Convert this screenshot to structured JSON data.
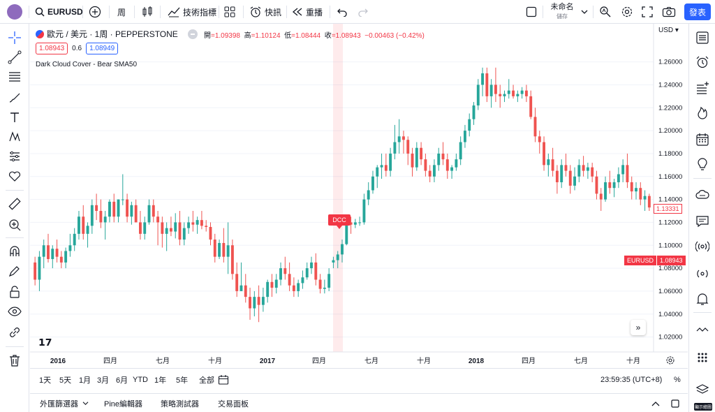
{
  "topbar": {
    "symbol": "EURUSD",
    "interval": "周",
    "indicators": "技術指標",
    "alert": "快訊",
    "replay": "重播",
    "layout_name": "未命名",
    "layout_save": "儲存",
    "signup": "發表"
  },
  "legend": {
    "pair": "歐元 / 美元 · 1周 · PEPPERSTONE",
    "o_lbl": "開",
    "o": "=1.09398",
    "h_lbl": "高",
    "h": "=1.10124",
    "l_lbl": "低",
    "l": "=1.08444",
    "c_lbl": "收",
    "c": "=1.08943",
    "chg": "−0.00463 (−0.42%)",
    "sell": "1.08943",
    "spread": "0.6",
    "buy": "1.08949",
    "study": "Dark Cloud Cover - Bear SMA50",
    "dcc": "DCC"
  },
  "axis": {
    "currency": "USD",
    "ticks": [
      "1.26000",
      "1.24000",
      "1.22000",
      "1.20000",
      "1.18000",
      "1.16000",
      "1.14000",
      "1.12000",
      "1.10000",
      "1.08000",
      "1.06000",
      "1.04000",
      "1.02000"
    ],
    "eur_tag": "EURUSD",
    "eur_price": "1.08943",
    "close_tag": "1.13331"
  },
  "xaxis": [
    "2016",
    "四月",
    "七月",
    "十月",
    "2017",
    "四月",
    "七月",
    "十月",
    "2018",
    "四月",
    "七月",
    "十月"
  ],
  "ranges": [
    "1天",
    "5天",
    "1月",
    "3月",
    "6月",
    "YTD",
    "1年",
    "5年",
    "全部"
  ],
  "time": "23:59:35 (UTC+8)",
  "pct": "%",
  "bottom": {
    "tabs": [
      "外匯篩選器",
      "Pine編輯器",
      "策略測試器",
      "交易面板"
    ]
  },
  "show_draw": "顯示繪圖",
  "colors": {
    "up": "#26a69a",
    "down": "#ef5350",
    "accent": "#2962ff"
  },
  "chart_data": {
    "type": "candlestick",
    "series": [
      {
        "o": 1.085,
        "h": 1.09,
        "l": 1.065,
        "c": 1.07
      },
      {
        "o": 1.07,
        "h": 1.095,
        "l": 1.06,
        "c": 1.09
      },
      {
        "o": 1.09,
        "h": 1.105,
        "l": 1.08,
        "c": 1.1
      },
      {
        "o": 1.1,
        "h": 1.11,
        "l": 1.085,
        "c": 1.088
      },
      {
        "o": 1.088,
        "h": 1.1,
        "l": 1.08,
        "c": 1.097
      },
      {
        "o": 1.097,
        "h": 1.105,
        "l": 1.085,
        "c": 1.09
      },
      {
        "o": 1.09,
        "h": 1.095,
        "l": 1.08,
        "c": 1.085
      },
      {
        "o": 1.085,
        "h": 1.098,
        "l": 1.08,
        "c": 1.095
      },
      {
        "o": 1.095,
        "h": 1.11,
        "l": 1.09,
        "c": 1.1
      },
      {
        "o": 1.1,
        "h": 1.115,
        "l": 1.095,
        "c": 1.11
      },
      {
        "o": 1.11,
        "h": 1.13,
        "l": 1.105,
        "c": 1.125
      },
      {
        "o": 1.125,
        "h": 1.135,
        "l": 1.105,
        "c": 1.11
      },
      {
        "o": 1.11,
        "h": 1.12,
        "l": 1.098,
        "c": 1.117
      },
      {
        "o": 1.117,
        "h": 1.14,
        "l": 1.11,
        "c": 1.135
      },
      {
        "o": 1.135,
        "h": 1.145,
        "l": 1.122,
        "c": 1.13
      },
      {
        "o": 1.13,
        "h": 1.14,
        "l": 1.115,
        "c": 1.12
      },
      {
        "o": 1.12,
        "h": 1.13,
        "l": 1.105,
        "c": 1.125
      },
      {
        "o": 1.125,
        "h": 1.14,
        "l": 1.12,
        "c": 1.138
      },
      {
        "o": 1.138,
        "h": 1.145,
        "l": 1.12,
        "c": 1.125
      },
      {
        "o": 1.125,
        "h": 1.14,
        "l": 1.12,
        "c": 1.14
      },
      {
        "o": 1.14,
        "h": 1.162,
        "l": 1.135,
        "c": 1.14
      },
      {
        "o": 1.14,
        "h": 1.145,
        "l": 1.12,
        "c": 1.125
      },
      {
        "o": 1.125,
        "h": 1.138,
        "l": 1.118,
        "c": 1.135
      },
      {
        "o": 1.135,
        "h": 1.14,
        "l": 1.12,
        "c": 1.12
      },
      {
        "o": 1.12,
        "h": 1.13,
        "l": 1.105,
        "c": 1.11
      },
      {
        "o": 1.11,
        "h": 1.125,
        "l": 1.105,
        "c": 1.12
      },
      {
        "o": 1.12,
        "h": 1.14,
        "l": 1.118,
        "c": 1.135
      },
      {
        "o": 1.135,
        "h": 1.14,
        "l": 1.12,
        "c": 1.125
      },
      {
        "o": 1.125,
        "h": 1.13,
        "l": 1.1,
        "c": 1.12
      },
      {
        "o": 1.12,
        "h": 1.125,
        "l": 1.098,
        "c": 1.11
      },
      {
        "o": 1.11,
        "h": 1.12,
        "l": 1.095,
        "c": 1.115
      },
      {
        "o": 1.115,
        "h": 1.125,
        "l": 1.108,
        "c": 1.112
      },
      {
        "o": 1.112,
        "h": 1.128,
        "l": 1.106,
        "c": 1.12
      },
      {
        "o": 1.12,
        "h": 1.13,
        "l": 1.1,
        "c": 1.105
      },
      {
        "o": 1.105,
        "h": 1.12,
        "l": 1.1,
        "c": 1.115
      },
      {
        "o": 1.115,
        "h": 1.125,
        "l": 1.11,
        "c": 1.12
      },
      {
        "o": 1.12,
        "h": 1.13,
        "l": 1.112,
        "c": 1.118
      },
      {
        "o": 1.118,
        "h": 1.125,
        "l": 1.11,
        "c": 1.122
      },
      {
        "o": 1.122,
        "h": 1.13,
        "l": 1.114,
        "c": 1.117
      },
      {
        "o": 1.117,
        "h": 1.122,
        "l": 1.112,
        "c": 1.116
      },
      {
        "o": 1.116,
        "h": 1.12,
        "l": 1.1,
        "c": 1.105
      },
      {
        "o": 1.105,
        "h": 1.11,
        "l": 1.085,
        "c": 1.09
      },
      {
        "o": 1.09,
        "h": 1.105,
        "l": 1.088,
        "c": 1.102
      },
      {
        "o": 1.102,
        "h": 1.115,
        "l": 1.085,
        "c": 1.09
      },
      {
        "o": 1.09,
        "h": 1.12,
        "l": 1.075,
        "c": 1.1
      },
      {
        "o": 1.1,
        "h": 1.105,
        "l": 1.07,
        "c": 1.075
      },
      {
        "o": 1.075,
        "h": 1.085,
        "l": 1.055,
        "c": 1.06
      },
      {
        "o": 1.06,
        "h": 1.085,
        "l": 1.06,
        "c": 1.065
      },
      {
        "o": 1.065,
        "h": 1.075,
        "l": 1.05,
        "c": 1.055
      },
      {
        "o": 1.055,
        "h": 1.063,
        "l": 1.035,
        "c": 1.045
      },
      {
        "o": 1.045,
        "h": 1.06,
        "l": 1.038,
        "c": 1.055
      },
      {
        "o": 1.055,
        "h": 1.065,
        "l": 1.033,
        "c": 1.048
      },
      {
        "o": 1.048,
        "h": 1.063,
        "l": 1.042,
        "c": 1.055
      },
      {
        "o": 1.055,
        "h": 1.07,
        "l": 1.05,
        "c": 1.068
      },
      {
        "o": 1.068,
        "h": 1.075,
        "l": 1.055,
        "c": 1.063
      },
      {
        "o": 1.063,
        "h": 1.075,
        "l": 1.058,
        "c": 1.07
      },
      {
        "o": 1.07,
        "h": 1.085,
        "l": 1.065,
        "c": 1.08
      },
      {
        "o": 1.08,
        "h": 1.09,
        "l": 1.07,
        "c": 1.075
      },
      {
        "o": 1.075,
        "h": 1.085,
        "l": 1.06,
        "c": 1.065
      },
      {
        "o": 1.065,
        "h": 1.072,
        "l": 1.055,
        "c": 1.06
      },
      {
        "o": 1.06,
        "h": 1.07,
        "l": 1.055,
        "c": 1.067
      },
      {
        "o": 1.067,
        "h": 1.078,
        "l": 1.062,
        "c": 1.072
      },
      {
        "o": 1.072,
        "h": 1.085,
        "l": 1.07,
        "c": 1.08
      },
      {
        "o": 1.08,
        "h": 1.09,
        "l": 1.075,
        "c": 1.085
      },
      {
        "o": 1.085,
        "h": 1.093,
        "l": 1.065,
        "c": 1.07
      },
      {
        "o": 1.07,
        "h": 1.075,
        "l": 1.058,
        "c": 1.062
      },
      {
        "o": 1.062,
        "h": 1.07,
        "l": 1.058,
        "c": 1.063
      },
      {
        "o": 1.063,
        "h": 1.08,
        "l": 1.06,
        "c": 1.075
      },
      {
        "o": 1.085,
        "h": 1.09,
        "l": 1.08,
        "c": 1.087
      },
      {
        "o": 1.087,
        "h": 1.095,
        "l": 1.08,
        "c": 1.092
      },
      {
        "o": 1.092,
        "h": 1.105,
        "l": 1.085,
        "c": 1.101
      },
      {
        "o": 1.101,
        "h": 1.12,
        "l": 1.1,
        "c": 1.12
      },
      {
        "o": 1.12,
        "h": 1.125,
        "l": 1.11,
        "c": 1.118
      },
      {
        "o": 1.118,
        "h": 1.123,
        "l": 1.115,
        "c": 1.12
      },
      {
        "o": 1.12,
        "h": 1.125,
        "l": 1.117,
        "c": 1.12
      },
      {
        "o": 1.12,
        "h": 1.145,
        "l": 1.118,
        "c": 1.14
      },
      {
        "o": 1.14,
        "h": 1.155,
        "l": 1.135,
        "c": 1.148
      },
      {
        "o": 1.148,
        "h": 1.165,
        "l": 1.145,
        "c": 1.16
      },
      {
        "o": 1.16,
        "h": 1.17,
        "l": 1.15,
        "c": 1.168
      },
      {
        "o": 1.168,
        "h": 1.18,
        "l": 1.158,
        "c": 1.17
      },
      {
        "o": 1.17,
        "h": 1.18,
        "l": 1.16,
        "c": 1.165
      },
      {
        "o": 1.165,
        "h": 1.185,
        "l": 1.16,
        "c": 1.18
      },
      {
        "o": 1.18,
        "h": 1.205,
        "l": 1.175,
        "c": 1.19
      },
      {
        "o": 1.19,
        "h": 1.21,
        "l": 1.18,
        "c": 1.195
      },
      {
        "o": 1.195,
        "h": 1.2,
        "l": 1.18,
        "c": 1.192
      },
      {
        "o": 1.192,
        "h": 1.195,
        "l": 1.17,
        "c": 1.18
      },
      {
        "o": 1.18,
        "h": 1.185,
        "l": 1.16,
        "c": 1.168
      },
      {
        "o": 1.168,
        "h": 1.19,
        "l": 1.165,
        "c": 1.185
      },
      {
        "o": 1.185,
        "h": 1.19,
        "l": 1.17,
        "c": 1.175
      },
      {
        "o": 1.175,
        "h": 1.18,
        "l": 1.16,
        "c": 1.165
      },
      {
        "o": 1.165,
        "h": 1.17,
        "l": 1.155,
        "c": 1.16
      },
      {
        "o": 1.16,
        "h": 1.175,
        "l": 1.155,
        "c": 1.17
      },
      {
        "o": 1.17,
        "h": 1.185,
        "l": 1.165,
        "c": 1.18
      },
      {
        "o": 1.18,
        "h": 1.19,
        "l": 1.17,
        "c": 1.175
      },
      {
        "o": 1.175,
        "h": 1.18,
        "l": 1.158,
        "c": 1.165
      },
      {
        "o": 1.165,
        "h": 1.17,
        "l": 1.158,
        "c": 1.168
      },
      {
        "o": 1.168,
        "h": 1.18,
        "l": 1.165,
        "c": 1.175
      },
      {
        "o": 1.175,
        "h": 1.195,
        "l": 1.17,
        "c": 1.19
      },
      {
        "o": 1.19,
        "h": 1.205,
        "l": 1.185,
        "c": 1.2
      },
      {
        "o": 1.2,
        "h": 1.215,
        "l": 1.195,
        "c": 1.21
      },
      {
        "o": 1.21,
        "h": 1.225,
        "l": 1.205,
        "c": 1.222
      },
      {
        "o": 1.222,
        "h": 1.245,
        "l": 1.218,
        "c": 1.24
      },
      {
        "o": 1.24,
        "h": 1.255,
        "l": 1.23,
        "c": 1.25
      },
      {
        "o": 1.25,
        "h": 1.255,
        "l": 1.225,
        "c": 1.23
      },
      {
        "o": 1.23,
        "h": 1.245,
        "l": 1.22,
        "c": 1.24
      },
      {
        "o": 1.24,
        "h": 1.255,
        "l": 1.225,
        "c": 1.232
      },
      {
        "o": 1.232,
        "h": 1.24,
        "l": 1.22,
        "c": 1.23
      },
      {
        "o": 1.23,
        "h": 1.235,
        "l": 1.225,
        "c": 1.232
      },
      {
        "o": 1.232,
        "h": 1.245,
        "l": 1.228,
        "c": 1.235
      },
      {
        "o": 1.235,
        "h": 1.24,
        "l": 1.228,
        "c": 1.23
      },
      {
        "o": 1.23,
        "h": 1.235,
        "l": 1.225,
        "c": 1.232
      },
      {
        "o": 1.232,
        "h": 1.238,
        "l": 1.228,
        "c": 1.235
      },
      {
        "o": 1.235,
        "h": 1.24,
        "l": 1.225,
        "c": 1.23
      },
      {
        "o": 1.23,
        "h": 1.235,
        "l": 1.21,
        "c": 1.212
      },
      {
        "o": 1.212,
        "h": 1.22,
        "l": 1.19,
        "c": 1.195
      },
      {
        "o": 1.195,
        "h": 1.2,
        "l": 1.18,
        "c": 1.19
      },
      {
        "o": 1.19,
        "h": 1.195,
        "l": 1.165,
        "c": 1.17
      },
      {
        "o": 1.17,
        "h": 1.18,
        "l": 1.16,
        "c": 1.175
      },
      {
        "o": 1.175,
        "h": 1.185,
        "l": 1.16,
        "c": 1.165
      },
      {
        "o": 1.165,
        "h": 1.17,
        "l": 1.145,
        "c": 1.155
      },
      {
        "o": 1.155,
        "h": 1.175,
        "l": 1.15,
        "c": 1.17
      },
      {
        "o": 1.17,
        "h": 1.18,
        "l": 1.16,
        "c": 1.165
      },
      {
        "o": 1.165,
        "h": 1.17,
        "l": 1.145,
        "c": 1.152
      },
      {
        "o": 1.152,
        "h": 1.168,
        "l": 1.148,
        "c": 1.16
      },
      {
        "o": 1.16,
        "h": 1.175,
        "l": 1.155,
        "c": 1.17
      },
      {
        "o": 1.17,
        "h": 1.178,
        "l": 1.16,
        "c": 1.165
      },
      {
        "o": 1.165,
        "h": 1.172,
        "l": 1.158,
        "c": 1.168
      },
      {
        "o": 1.168,
        "h": 1.172,
        "l": 1.155,
        "c": 1.16
      },
      {
        "o": 1.16,
        "h": 1.165,
        "l": 1.14,
        "c": 1.145
      },
      {
        "o": 1.145,
        "h": 1.15,
        "l": 1.13,
        "c": 1.14
      },
      {
        "o": 1.14,
        "h": 1.16,
        "l": 1.138,
        "c": 1.155
      },
      {
        "o": 1.155,
        "h": 1.165,
        "l": 1.145,
        "c": 1.15
      },
      {
        "o": 1.15,
        "h": 1.158,
        "l": 1.142,
        "c": 1.155
      },
      {
        "o": 1.155,
        "h": 1.168,
        "l": 1.15,
        "c": 1.162
      },
      {
        "o": 1.162,
        "h": 1.175,
        "l": 1.155,
        "c": 1.17
      },
      {
        "o": 1.17,
        "h": 1.18,
        "l": 1.15,
        "c": 1.155
      },
      {
        "o": 1.155,
        "h": 1.16,
        "l": 1.14,
        "c": 1.147
      },
      {
        "o": 1.147,
        "h": 1.155,
        "l": 1.14,
        "c": 1.15
      },
      {
        "o": 1.15,
        "h": 1.155,
        "l": 1.135,
        "c": 1.14
      },
      {
        "o": 1.14,
        "h": 1.148,
        "l": 1.13,
        "c": 1.143
      },
      {
        "o": 1.143,
        "h": 1.145,
        "l": 1.13,
        "c": 1.133
      }
    ],
    "ylim": [
      1.01,
      1.275
    ]
  }
}
